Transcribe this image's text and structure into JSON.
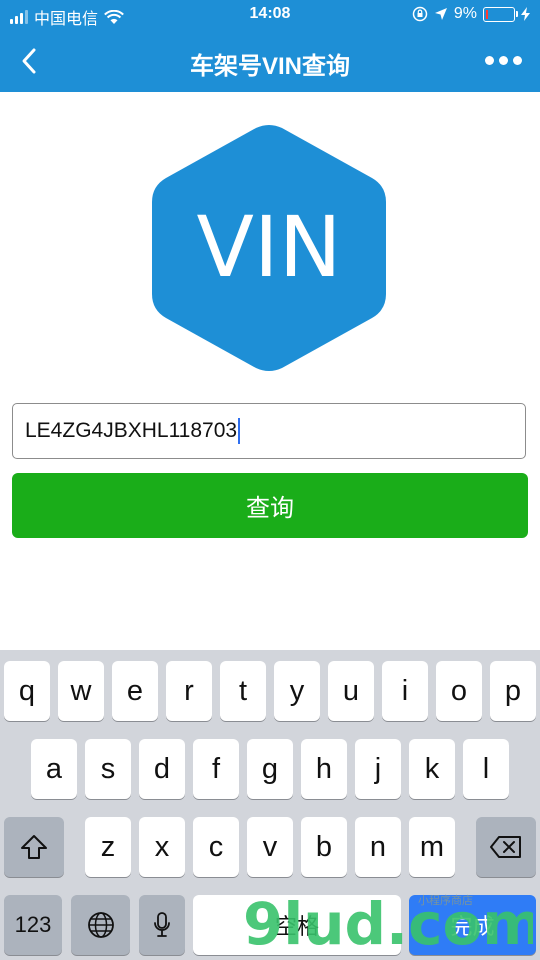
{
  "status_bar": {
    "carrier": "中国电信",
    "time": "14:08",
    "battery_percent": "9%",
    "battery_level": 0.09,
    "icons": [
      "signal-icon",
      "wifi-icon",
      "rotation-lock-icon",
      "location-arrow-icon",
      "battery-icon",
      "charging-bolt-icon"
    ]
  },
  "nav": {
    "title": "车架号VIN查询",
    "back_icon": "chevron-left-icon",
    "more_icon": "more-dots-icon"
  },
  "logo": {
    "text": "VIN",
    "color": "#1e8fd6"
  },
  "form": {
    "vin_value": "LE4ZG4JBXHL118703",
    "submit_label": "查询",
    "submit_color": "#1aad19"
  },
  "keyboard": {
    "row1": [
      "q",
      "w",
      "e",
      "r",
      "t",
      "y",
      "u",
      "i",
      "o",
      "p"
    ],
    "row2": [
      "a",
      "s",
      "d",
      "f",
      "g",
      "h",
      "j",
      "k",
      "l"
    ],
    "row3": [
      "z",
      "x",
      "c",
      "v",
      "b",
      "n",
      "m"
    ],
    "mode_label": "123",
    "space_label": "空格",
    "done_label": "完成",
    "icons": [
      "shift-icon",
      "backspace-icon",
      "globe-icon",
      "microphone-icon"
    ]
  },
  "watermark": {
    "text": "9lud.com",
    "sub_text": "小程序商店"
  },
  "colors": {
    "primary": "#1e8fd6",
    "accent_green": "#1aad19",
    "keyboard_bg": "#d2d5db",
    "done_key": "#2f7cf6"
  }
}
